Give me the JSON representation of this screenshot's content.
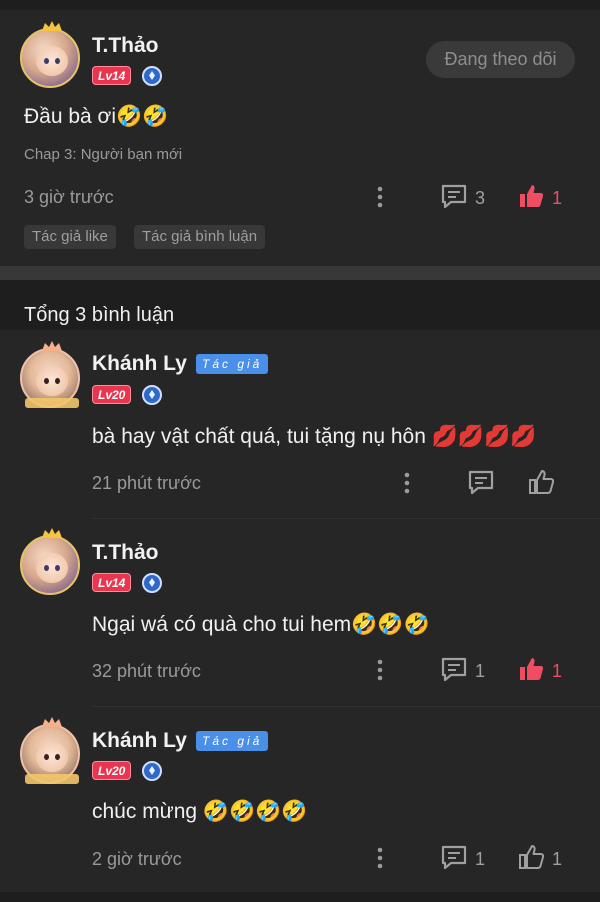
{
  "post": {
    "user": "T.Thảo",
    "level": "Lv14",
    "follow_label": "Đang theo dõi",
    "content": "Đầu bà ơi🤣🤣",
    "chapter": "Chap 3: Người bạn mới",
    "time": "3 giờ trước",
    "comment_count": "3",
    "like_count": "1",
    "chips": [
      "Tác giả like",
      "Tác giả bình luận"
    ]
  },
  "comments_header": "Tổng 3 bình luận",
  "comments": [
    {
      "user": "Khánh Ly",
      "badge": "Tác giả",
      "level": "Lv20",
      "content": "bà hay vật chất quá, tui tặng nụ hôn 💋💋💋💋",
      "time": "21 phút trước",
      "comment_count": "",
      "like_count": ""
    },
    {
      "user": "T.Thảo",
      "badge": "",
      "level": "Lv14",
      "content": "Ngại wá có quà cho tui hem🤣🤣🤣",
      "time": "32 phút trước",
      "comment_count": "1",
      "like_count": "1"
    },
    {
      "user": "Khánh Ly",
      "badge": "Tác giả",
      "level": "Lv20",
      "content": "chúc mừng 🤣🤣🤣🤣",
      "time": "2 giờ trước",
      "comment_count": "1",
      "like_count": "1"
    }
  ],
  "colors": {
    "accent_red": "#f04d63",
    "author_blue": "#4a8fe8",
    "level_red": "#e9354f"
  },
  "icons": [
    "more-vertical-icon",
    "comment-icon",
    "thumbs-up-icon",
    "diamond-badge-icon"
  ]
}
